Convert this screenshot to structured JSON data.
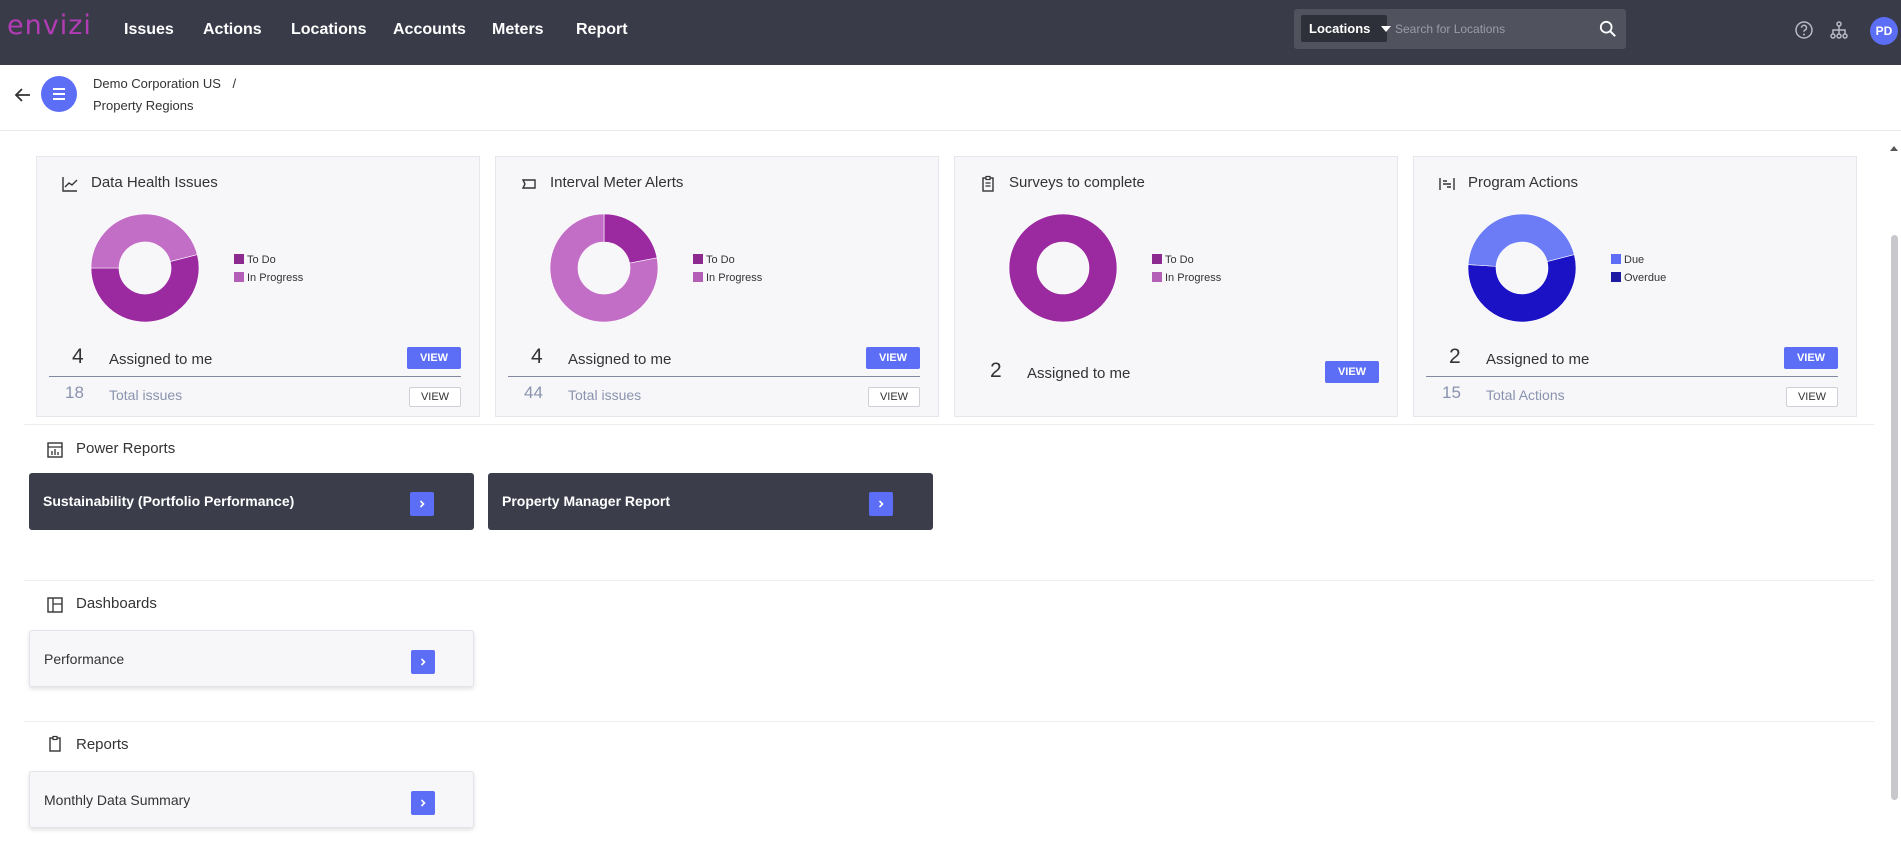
{
  "app": {
    "logo": "envizi"
  },
  "nav": {
    "items": [
      {
        "label": "Issues"
      },
      {
        "label": "Actions"
      },
      {
        "label": "Locations"
      },
      {
        "label": "Accounts"
      },
      {
        "label": "Meters"
      },
      {
        "label": "Report"
      }
    ]
  },
  "search": {
    "scope": "Locations",
    "placeholder": "Search for Locations"
  },
  "user": {
    "initials": "PD"
  },
  "breadcrumb": {
    "parent": "Demo Corporation US",
    "separator": "/",
    "current": "Property Regions"
  },
  "widgets": [
    {
      "title": "Data Health Issues",
      "icon": "line-chart-icon",
      "legend": [
        {
          "label": "To Do",
          "color": "#8c2a8f"
        },
        {
          "label": "In Progress",
          "color": "#b45fb7"
        }
      ],
      "chart": {
        "segments": [
          {
            "label": "To Do",
            "fraction": 0.54,
            "color": "#9b2aa0"
          },
          {
            "label": "In Progress",
            "fraction": 0.46,
            "color": "#c36ec6"
          }
        ],
        "start_fraction": 0.21
      },
      "assigned": {
        "count": "4",
        "label": "Assigned to me",
        "button": "VIEW"
      },
      "total": {
        "count": "18",
        "label": "Total issues",
        "button": "VIEW"
      }
    },
    {
      "title": "Interval Meter Alerts",
      "icon": "meter-icon",
      "legend": [
        {
          "label": "To Do",
          "color": "#8c2a8f"
        },
        {
          "label": "In Progress",
          "color": "#b45fb7"
        }
      ],
      "chart": {
        "segments": [
          {
            "label": "To Do",
            "fraction": 0.22,
            "color": "#9b2aa0"
          },
          {
            "label": "In Progress",
            "fraction": 0.78,
            "color": "#c36ec6"
          }
        ],
        "start_fraction": 0.0
      },
      "assigned": {
        "count": "4",
        "label": "Assigned to me",
        "button": "VIEW"
      },
      "total": {
        "count": "44",
        "label": "Total issues",
        "button": "VIEW"
      }
    },
    {
      "title": "Surveys to complete",
      "icon": "clipboard-icon",
      "legend": [
        {
          "label": "To Do",
          "color": "#8c2a8f"
        },
        {
          "label": "In Progress",
          "color": "#b45fb7"
        }
      ],
      "chart": {
        "segments": [
          {
            "label": "To Do",
            "fraction": 1.0,
            "color": "#9b2aa0"
          }
        ],
        "start_fraction": 0.0
      },
      "assigned": {
        "count": "2",
        "label": "Assigned to me",
        "button": "VIEW"
      }
    },
    {
      "title": "Program Actions",
      "icon": "program-icon",
      "legend": [
        {
          "label": "Due",
          "color": "#5b6ef5"
        },
        {
          "label": "Overdue",
          "color": "#1b1aa0"
        }
      ],
      "chart": {
        "segments": [
          {
            "label": "Overdue",
            "fraction": 0.55,
            "color": "#1a12c4"
          },
          {
            "label": "Due",
            "fraction": 0.45,
            "color": "#6c7cf6"
          }
        ],
        "start_fraction": 0.21
      },
      "assigned": {
        "count": "2",
        "label": "Assigned to me",
        "button": "VIEW"
      },
      "total": {
        "count": "15",
        "label": "Total Actions",
        "button": "VIEW"
      }
    }
  ],
  "sections": {
    "power_reports": {
      "title": "Power Reports",
      "items": [
        "Sustainability (Portfolio Performance)",
        "Property Manager Report"
      ]
    },
    "dashboards": {
      "title": "Dashboards",
      "items": [
        "Performance"
      ]
    },
    "reports": {
      "title": "Reports",
      "items": [
        "Monthly Data Summary"
      ]
    }
  }
}
